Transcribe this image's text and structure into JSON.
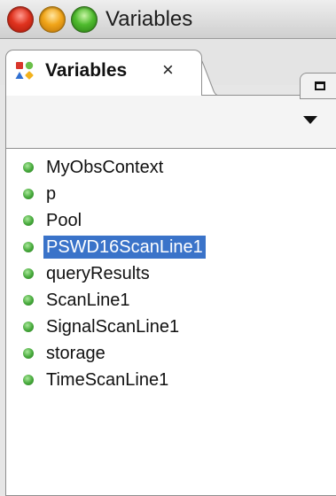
{
  "window": {
    "title": "Variables"
  },
  "tab": {
    "label": "Variables",
    "close_glyph": "×",
    "icon": "variables-view-icon"
  },
  "colors": {
    "selection": "#3a73c9",
    "item_dot": "#45a83a"
  },
  "variables": [
    {
      "name": "MyObsContext",
      "selected": false
    },
    {
      "name": "p",
      "selected": false
    },
    {
      "name": "Pool",
      "selected": false
    },
    {
      "name": "PSWD16ScanLine1",
      "selected": true
    },
    {
      "name": "queryResults",
      "selected": false
    },
    {
      "name": "ScanLine1",
      "selected": false
    },
    {
      "name": "SignalScanLine1",
      "selected": false
    },
    {
      "name": "storage",
      "selected": false
    },
    {
      "name": "TimeScanLine1",
      "selected": false
    }
  ]
}
